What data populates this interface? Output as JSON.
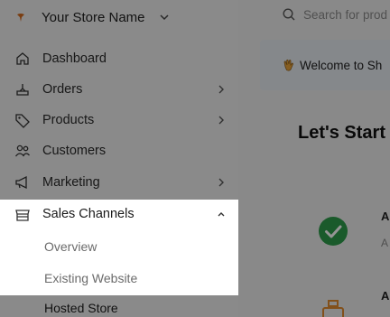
{
  "store": {
    "name": "Your Store Name"
  },
  "nav": {
    "items": [
      {
        "label": "Dashboard",
        "icon": "home-icon",
        "has_arrow": false
      },
      {
        "label": "Orders",
        "icon": "orders-icon",
        "has_arrow": true
      },
      {
        "label": "Products",
        "icon": "tag-icon",
        "has_arrow": true
      },
      {
        "label": "Customers",
        "icon": "customers-icon",
        "has_arrow": false
      },
      {
        "label": "Marketing",
        "icon": "megaphone-icon",
        "has_arrow": true
      }
    ],
    "sales_channels": {
      "label": "Sales Channels",
      "icon": "storefront-icon",
      "sub_items": [
        "Overview",
        "Existing Website",
        "Hosted Store"
      ]
    }
  },
  "search": {
    "placeholder": "Search for prod"
  },
  "welcome": {
    "text": "Welcome to Sh"
  },
  "main": {
    "heading": "Let's Start",
    "step1_title": "A",
    "step1_sub": "A",
    "step2_title": "A"
  },
  "colors": {
    "accent": "#e08b2f",
    "success": "#2e9c4a",
    "overlay": "rgba(0,0,0,0.42)"
  }
}
